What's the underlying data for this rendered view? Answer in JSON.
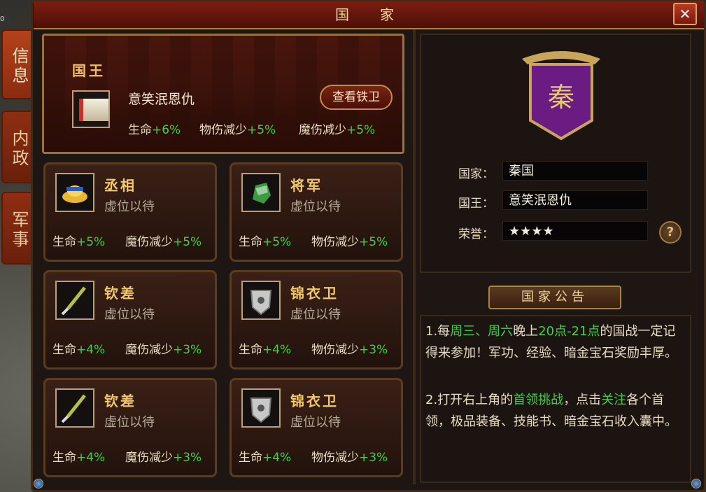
{
  "window": {
    "title": "国　家",
    "close_label": "✕",
    "coord_text": "0"
  },
  "side_tabs": [
    {
      "label": "信息",
      "active": true
    },
    {
      "label": "内政",
      "active": false
    },
    {
      "label": "军事",
      "active": false
    }
  ],
  "king": {
    "title": "国王",
    "name": "意笑泯恩仇",
    "view_guards_label": "查看铁卫",
    "attrs": [
      {
        "label": "生命",
        "value": "+6%"
      },
      {
        "label": "物伤减少",
        "value": "+5%"
      },
      {
        "label": "魔伤减少",
        "value": "+5%"
      }
    ]
  },
  "offices": [
    {
      "rank": "丞相",
      "status": "虚位以待",
      "icon": "gold-ingot-icon",
      "attr1": {
        "label": "生命",
        "value": "+5%"
      },
      "attr2": {
        "label": "魔伤减少",
        "value": "+5%"
      }
    },
    {
      "rank": "将军",
      "status": "虚位以待",
      "icon": "helmet-icon",
      "attr1": {
        "label": "生命",
        "value": "+5%"
      },
      "attr2": {
        "label": "物伤减少",
        "value": "+5%"
      }
    },
    {
      "rank": "钦差",
      "status": "虚位以待",
      "icon": "brush-icon",
      "attr1": {
        "label": "生命",
        "value": "+4%"
      },
      "attr2": {
        "label": "魔伤减少",
        "value": "+3%"
      }
    },
    {
      "rank": "锦衣卫",
      "status": "虚位以待",
      "icon": "armor-icon",
      "attr1": {
        "label": "生命",
        "value": "+4%"
      },
      "attr2": {
        "label": "物伤减少",
        "value": "+3%"
      }
    },
    {
      "rank": "钦差",
      "status": "虚位以待",
      "icon": "brush-icon",
      "attr1": {
        "label": "生命",
        "value": "+4%"
      },
      "attr2": {
        "label": "魔伤减少",
        "value": "+3%"
      }
    },
    {
      "rank": "锦衣卫",
      "status": "虚位以待",
      "icon": "armor-icon",
      "attr1": {
        "label": "生命",
        "value": "+4%"
      },
      "attr2": {
        "label": "物伤减少",
        "value": "+3%"
      }
    }
  ],
  "nation": {
    "emblem_char": "秦",
    "fields": [
      {
        "label": "国家：",
        "value": "秦国"
      },
      {
        "label": "国王：",
        "value": "意笑泯恩仇"
      },
      {
        "label": "荣誉：",
        "value": "★★★★"
      }
    ],
    "help_label": "?"
  },
  "notice": {
    "header": "国家公告",
    "p1": [
      "1.每",
      "周三、周六",
      "晚上",
      "20点-21点",
      "的国战一定记得来参加！军功、经验、暗金宝石奖励丰厚。"
    ],
    "p2": [
      "2.打开右上角的",
      "首领挑战",
      "，点击",
      "关注",
      "各个首领，极品装备、技能书、暗金宝石收入囊中。"
    ]
  },
  "colors": {
    "accent_green": "#3cd24a",
    "gold": "#f2c868",
    "frame_red": "#7c1e10"
  }
}
